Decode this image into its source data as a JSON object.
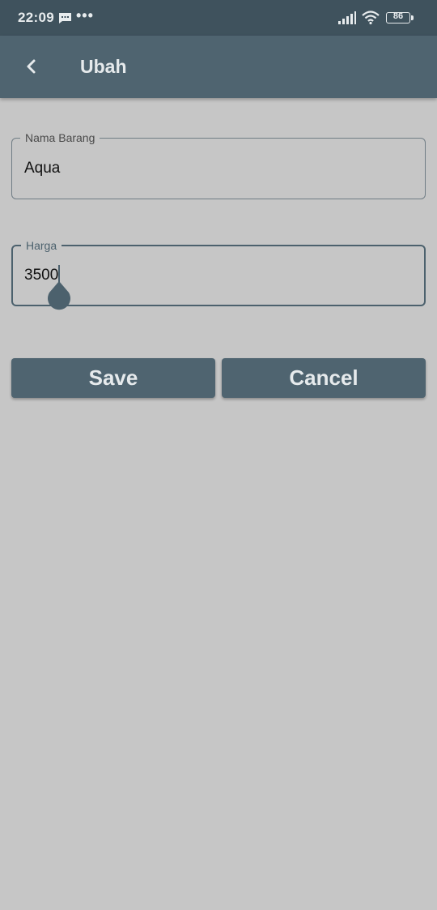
{
  "status_bar": {
    "time": "22:09",
    "dots": "•••",
    "battery": "86"
  },
  "app_bar": {
    "title": "Ubah"
  },
  "form": {
    "nama_barang": {
      "label": "Nama Barang",
      "value": "Aqua"
    },
    "harga": {
      "label": "Harga",
      "value": "3500"
    }
  },
  "buttons": {
    "save": "Save",
    "cancel": "Cancel"
  },
  "colors": {
    "primary": "#4f6470",
    "status_bar": "#3f525d",
    "background": "#c6c6c6"
  }
}
